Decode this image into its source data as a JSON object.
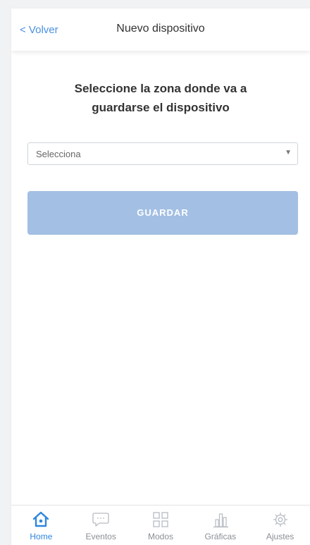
{
  "header": {
    "back_label": "< Volver",
    "title": "Nuevo dispositivo"
  },
  "main": {
    "heading_line1": "Seleccione la zona donde va a",
    "heading_line2": "guardarse el dispositivo",
    "select": {
      "value": "Selecciona",
      "arrow": "▼"
    },
    "save_label": "GUARDAR"
  },
  "bottom_nav": {
    "items": [
      {
        "label": "Home",
        "icon": "home-icon",
        "active": true
      },
      {
        "label": "Eventos",
        "icon": "chat-bubble-icon",
        "active": false
      },
      {
        "label": "Modos",
        "icon": "grid-icon",
        "active": false
      },
      {
        "label": "Gráficas",
        "icon": "bar-chart-icon",
        "active": false
      },
      {
        "label": "Ajustes",
        "icon": "gear-icon",
        "active": false
      }
    ]
  },
  "colors": {
    "accent": "#4a90e2",
    "active_nav": "#2e86de",
    "button_disabled": "#a3bfe3",
    "inactive": "#8a8f96"
  }
}
